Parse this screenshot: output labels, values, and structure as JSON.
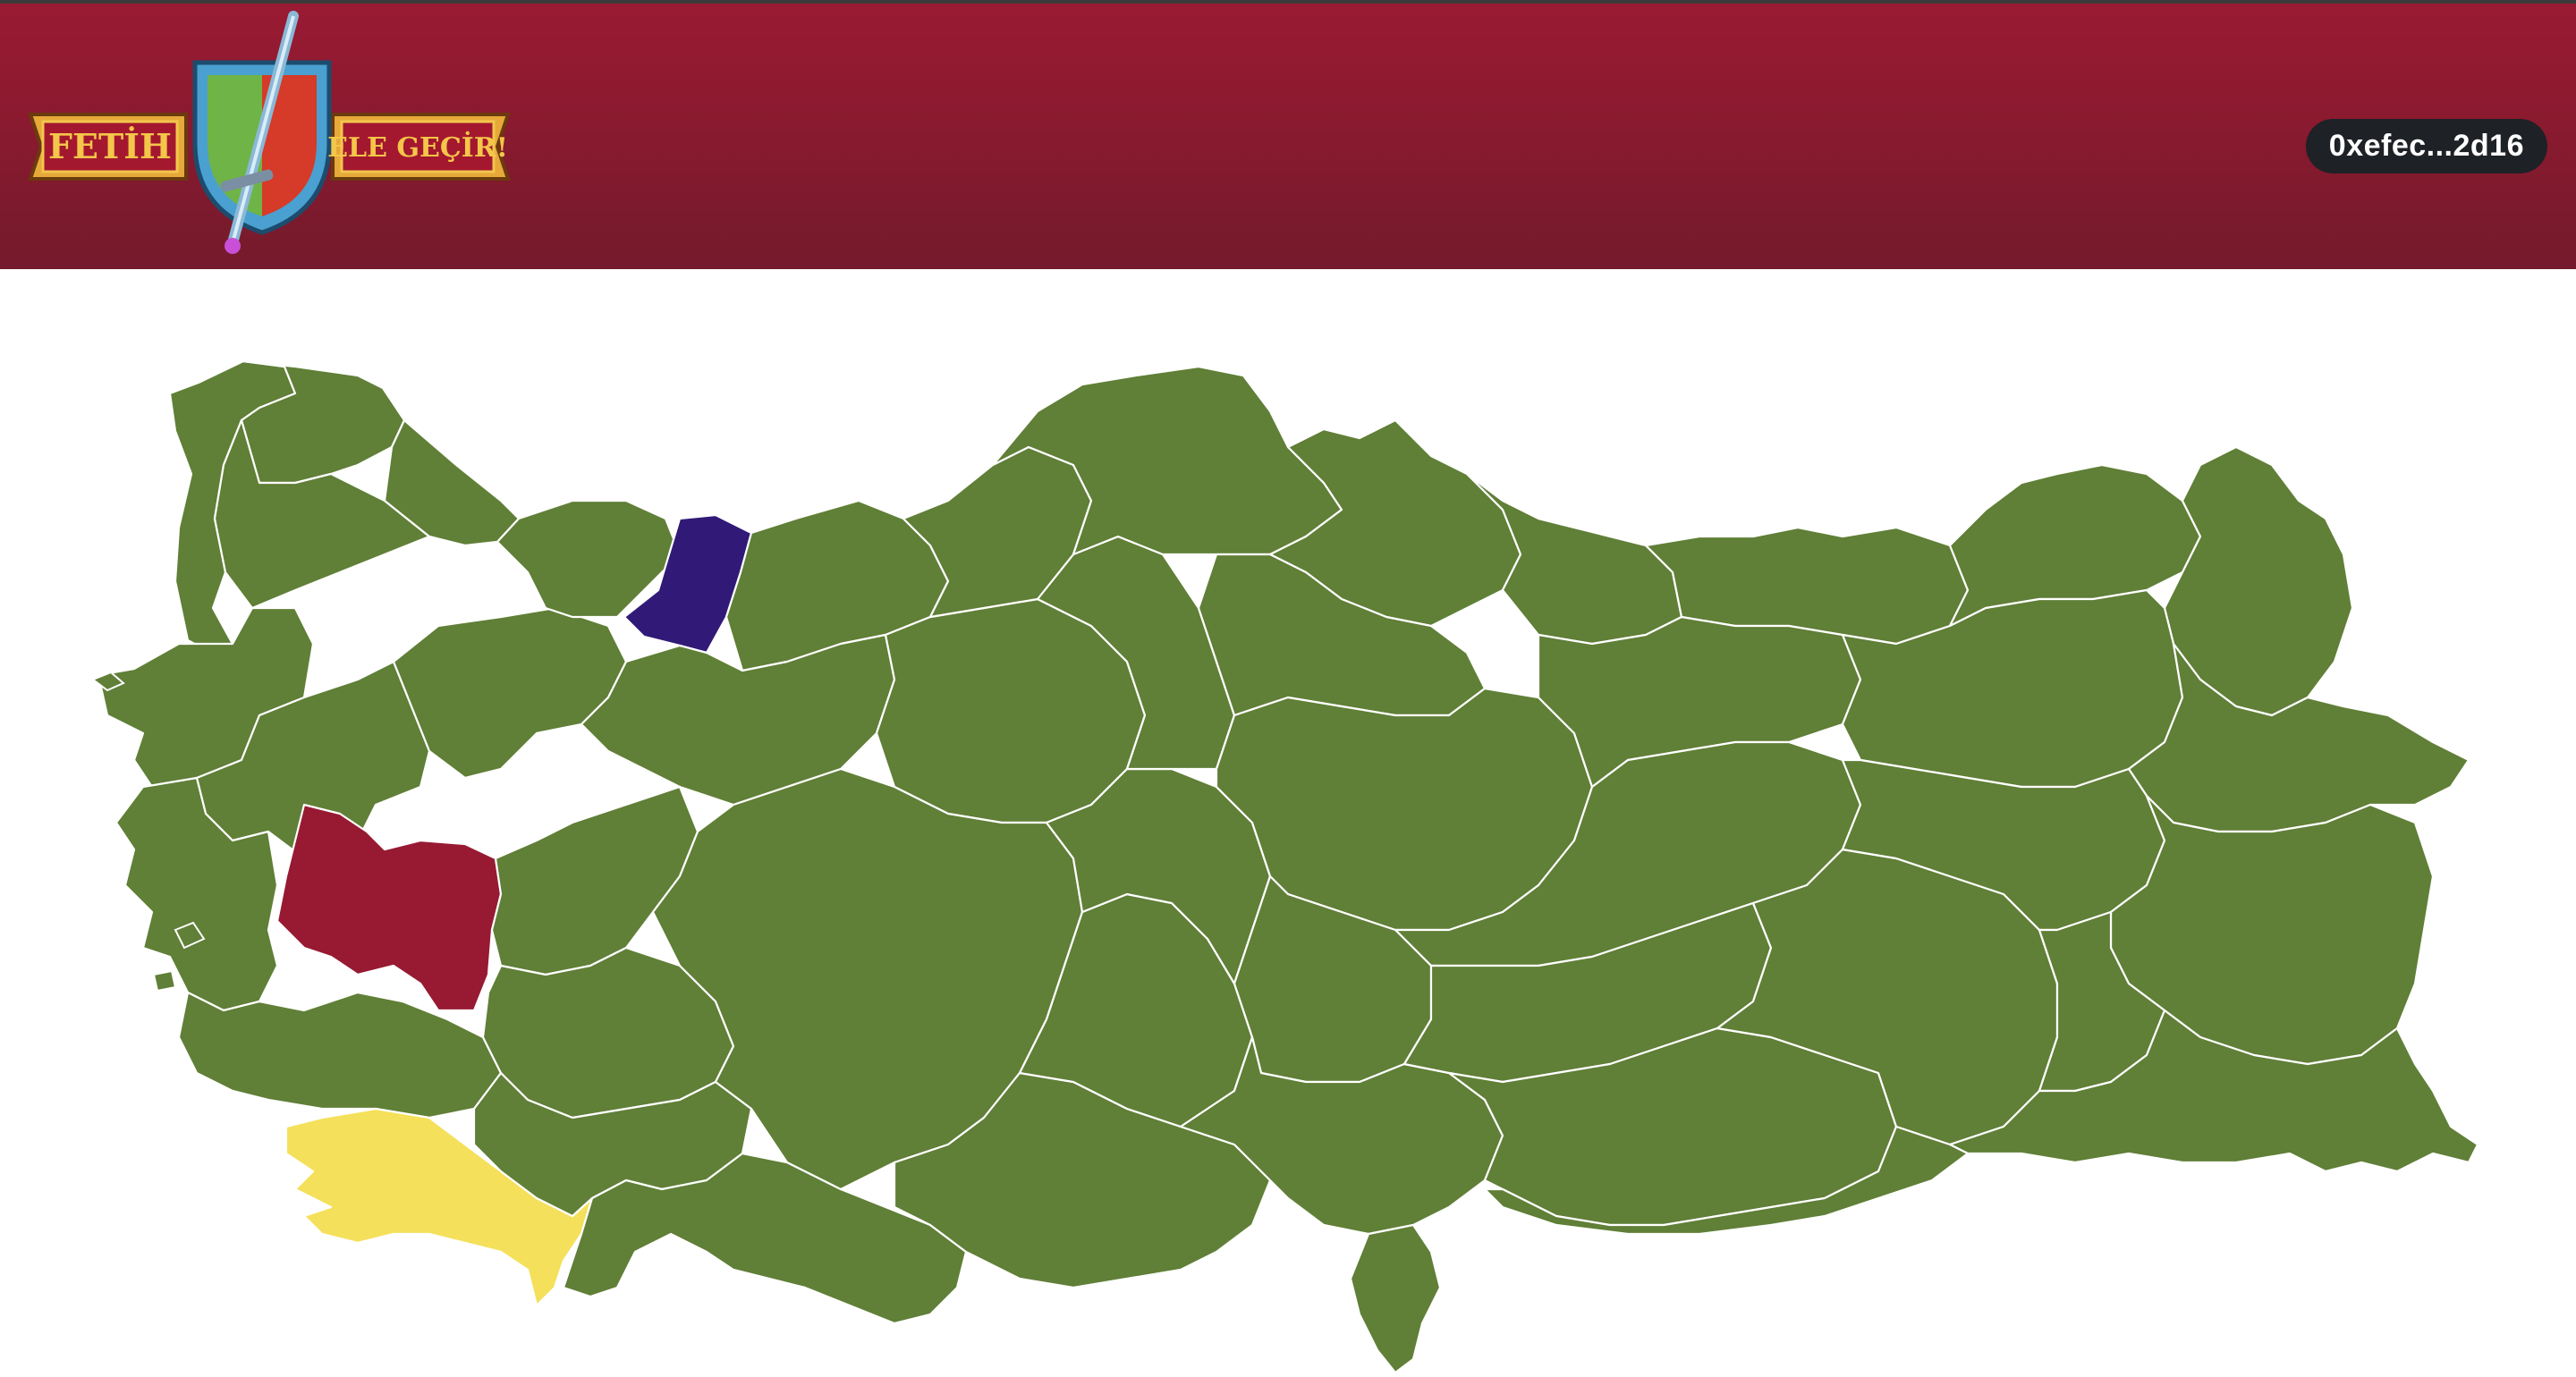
{
  "header": {
    "logo": {
      "left_banner": "FETİH",
      "right_banner": "ELE GEÇİR!",
      "emblem_icon": "shield-sword-icon"
    },
    "wallet_address": "0xefec...2d16"
  },
  "map": {
    "country": "Turkey",
    "colors": {
      "default": "#607f37",
      "player_red": "#971a32",
      "player_purple": "#311a77",
      "player_yellow": "#f4e05a",
      "border": "#ffffff"
    },
    "highlighted_provinces": [
      {
        "region": "west-inland",
        "color": "#971a32"
      },
      {
        "region": "northwest-coast",
        "color": "#311a77"
      },
      {
        "region": "southwest-coast",
        "color": "#f4e05a"
      }
    ]
  }
}
